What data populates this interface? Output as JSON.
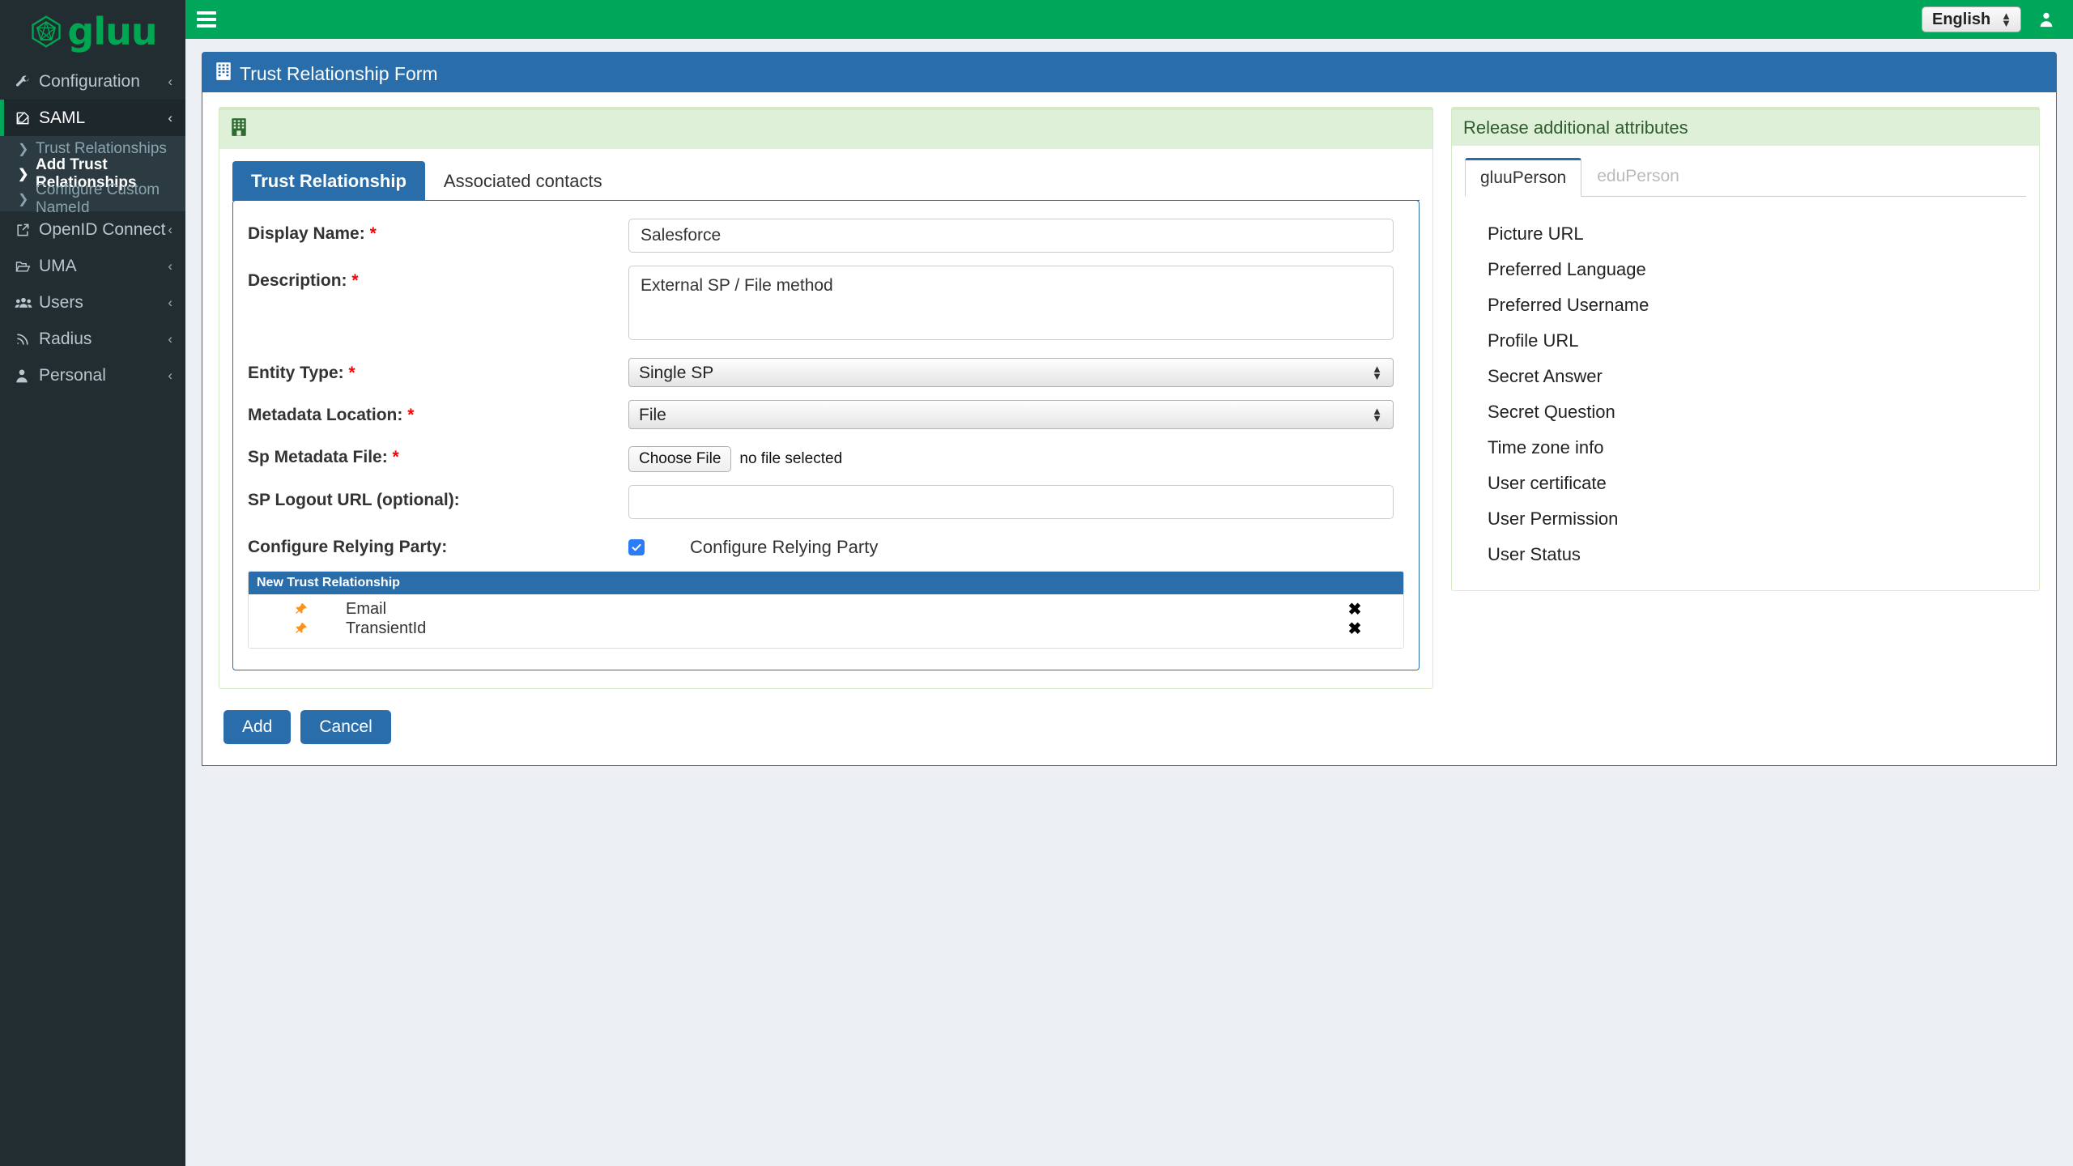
{
  "brand": {
    "name": "gluu",
    "logo_icon": "gluu-polyhedron-logo",
    "color": "#00a651"
  },
  "header": {
    "menu_toggle_icon": "hamburger-menu-icon",
    "language_value": "English",
    "language_options": [
      "English"
    ],
    "user_icon": "user-avatar-icon",
    "bg_color": "#00a65a"
  },
  "sidebar": {
    "items": [
      {
        "label": "Configuration",
        "icon": "wrench-icon",
        "caret": "‹",
        "active": false
      },
      {
        "label": "SAML",
        "icon": "edit-square-icon",
        "caret": "‹",
        "active": true
      },
      {
        "label": "OpenID Connect",
        "icon": "external-link-icon",
        "caret": "‹",
        "active": false
      },
      {
        "label": "UMA",
        "icon": "folder-open-icon",
        "caret": "‹",
        "active": false
      },
      {
        "label": "Users",
        "icon": "users-icon",
        "caret": "‹",
        "active": false
      },
      {
        "label": "Radius",
        "icon": "rss-icon",
        "caret": "‹",
        "active": false
      },
      {
        "label": "Personal",
        "icon": "person-icon",
        "caret": "‹",
        "active": false
      }
    ],
    "saml_submenu": [
      {
        "label": "Trust Relationships",
        "current": false
      },
      {
        "label": "Add Trust Relationships",
        "current": true
      },
      {
        "label": "Configure Custom NameId",
        "current": false
      }
    ]
  },
  "page": {
    "title": "Trust Relationship Form",
    "title_icon": "building-icon",
    "panel_color": "#2a6dab"
  },
  "form_panel": {
    "status_icon": "building-green-icon",
    "status_text": "",
    "tabs": [
      {
        "label": "Trust Relationship",
        "active": true
      },
      {
        "label": "Associated contacts",
        "active": false
      }
    ],
    "fields": {
      "display_name": {
        "label": "Display Name:",
        "required": true,
        "value": "Salesforce",
        "placeholder": ""
      },
      "description": {
        "label": "Description:",
        "required": true,
        "value": "External SP / File method",
        "placeholder": ""
      },
      "entity_type": {
        "label": "Entity Type:",
        "required": true,
        "value": "Single SP",
        "options": [
          "Single SP"
        ]
      },
      "metadata_location": {
        "label": "Metadata Location:",
        "required": true,
        "value": "File",
        "options": [
          "File"
        ]
      },
      "sp_metadata_file": {
        "label": "Sp Metadata File:",
        "required": true,
        "button_label": "Choose File",
        "status": "no file selected"
      },
      "sp_logout_url": {
        "label": "SP Logout URL (optional):",
        "required": false,
        "value": "",
        "placeholder": ""
      },
      "configure_relying_party": {
        "label": "Configure Relying Party:",
        "required": false,
        "checked": true,
        "checkbox_label": "Configure Relying Party"
      }
    },
    "inner_table": {
      "title": "New Trust Relationship",
      "rows": [
        {
          "pin_icon": "pushpin-icon",
          "name": "Email",
          "remove_icon": "close-x-icon"
        },
        {
          "pin_icon": "pushpin-icon",
          "name": "TransientId",
          "remove_icon": "close-x-icon"
        }
      ]
    },
    "buttons": [
      {
        "label": "Add",
        "name": "add-button"
      },
      {
        "label": "Cancel",
        "name": "cancel-button"
      }
    ]
  },
  "release_panel": {
    "title": "Release additional attributes",
    "tabs": [
      {
        "label": "gluuPerson",
        "active": true
      },
      {
        "label": "eduPerson",
        "active": false
      }
    ],
    "attributes": [
      "Picture URL",
      "Preferred Language",
      "Preferred Username",
      "Profile URL",
      "Secret Answer",
      "Secret Question",
      "Time zone info",
      "User certificate",
      "User Permission",
      "User Status"
    ]
  }
}
